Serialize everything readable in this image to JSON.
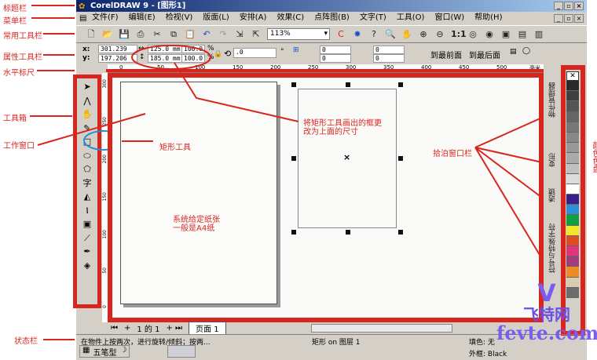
{
  "annotations": {
    "title_bar": "标题栏",
    "menu_bar": "菜单栏",
    "standard_toolbar": "常用工具栏",
    "property_bar": "属性工具栏",
    "horizontal_ruler": "水平标尺",
    "toolbox": "工具箱",
    "work_window": "工作窗口",
    "status_bar": "状态栏",
    "rect_tool": "矩形工具",
    "paper_note_1": "系统给定纸张",
    "paper_note_2": "一般是A4纸",
    "size_note_1": "将矩形工具画出的框更",
    "size_note_2": "改为上面的尺寸",
    "docker_bar": "拾泊窗口栏",
    "palette": "颜色色盘"
  },
  "window": {
    "title": "CorelDRAW 9 - [图形1]"
  },
  "menu": [
    "文件(F)",
    "编辑(E)",
    "检视(V)",
    "版面(L)",
    "安排(A)",
    "效果(C)",
    "点阵图(B)",
    "文字(T)",
    "工具(O)",
    "窗口(W)",
    "帮助(H)"
  ],
  "toolbar": {
    "zoom": "113%"
  },
  "props": {
    "x_label": "x:",
    "y_label": "y:",
    "x": "301.239",
    "y": "197.206",
    "width": "125.0 mm",
    "height": "185.0 mm",
    "scale_x": "100.0",
    "scale_y": "100.0",
    "pct": "%",
    "angle": ".0",
    "deg": "°",
    "c1": "0",
    "c2": "0",
    "c3": "0",
    "c4": "0",
    "to_front": "到最前面",
    "to_back": "到最后面"
  },
  "ruler": {
    "ticks": [
      "0",
      "50",
      "100",
      "150",
      "200",
      "250",
      "300",
      "350",
      "400",
      "450",
      "500"
    ],
    "unit": "毫米",
    "vticks": [
      "300",
      "250",
      "200",
      "150",
      "100",
      "50",
      "0"
    ]
  },
  "docker_tabs": [
    "物件管理器",
    "变形",
    "透镜",
    "符号与特殊字符"
  ],
  "palette_colors": [
    "#2a2a2a",
    "#404040",
    "#555",
    "#666",
    "#777",
    "#888",
    "#999",
    "#aaa",
    "#c0c0c0",
    "#dcdcdc",
    "#ffffff",
    "#3a1f8a",
    "#2f8fd6",
    "#10a040",
    "#f2e62a",
    "#e04a24",
    "#e0357a",
    "#a23c7c",
    "#f08a24",
    "#d8ccb0",
    "#6d6d6d"
  ],
  "pagenav": {
    "pos": "1 的 1",
    "page_tab": "页面 1"
  },
  "status": {
    "hint": "在物件上按两次，进行旋转/倾斜；按两...",
    "object": "矩形 on 图层 1",
    "fill": "填色: 无",
    "outline": "外框: Black",
    "ime": "五笔型"
  },
  "watermark": "fevte.com",
  "watermark_cn": "飞特网"
}
